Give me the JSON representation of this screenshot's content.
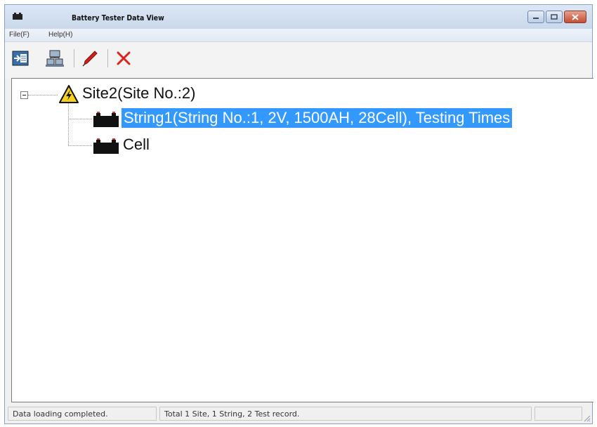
{
  "window": {
    "title": "Battery Tester Data View",
    "icon": "battery-icon"
  },
  "menu": [
    {
      "label": "File(F)"
    },
    {
      "label": "Help(H)"
    }
  ],
  "toolbar": [
    {
      "icon": "import-icon"
    },
    {
      "icon": "network-icon"
    },
    {
      "icon": "edit-pen-icon"
    },
    {
      "icon": "delete-icon"
    }
  ],
  "tree": {
    "site": {
      "label": "Site2(Site No.:2)",
      "icon": "warning-icon"
    },
    "children": [
      {
        "label": "String1(String No.:1, 2V, 1500AH, 28Cell), Testing Times",
        "icon": "battery-icon",
        "selected": true
      },
      {
        "label": "Cell",
        "icon": "battery-icon",
        "selected": false
      }
    ]
  },
  "status": {
    "left": "Data loading completed.",
    "middle": "Total 1 Site, 1 String, 2 Test record.",
    "right": ""
  },
  "colors": {
    "selection": "#3399ff",
    "delete": "#e0201b",
    "pen": "#d0201a"
  }
}
